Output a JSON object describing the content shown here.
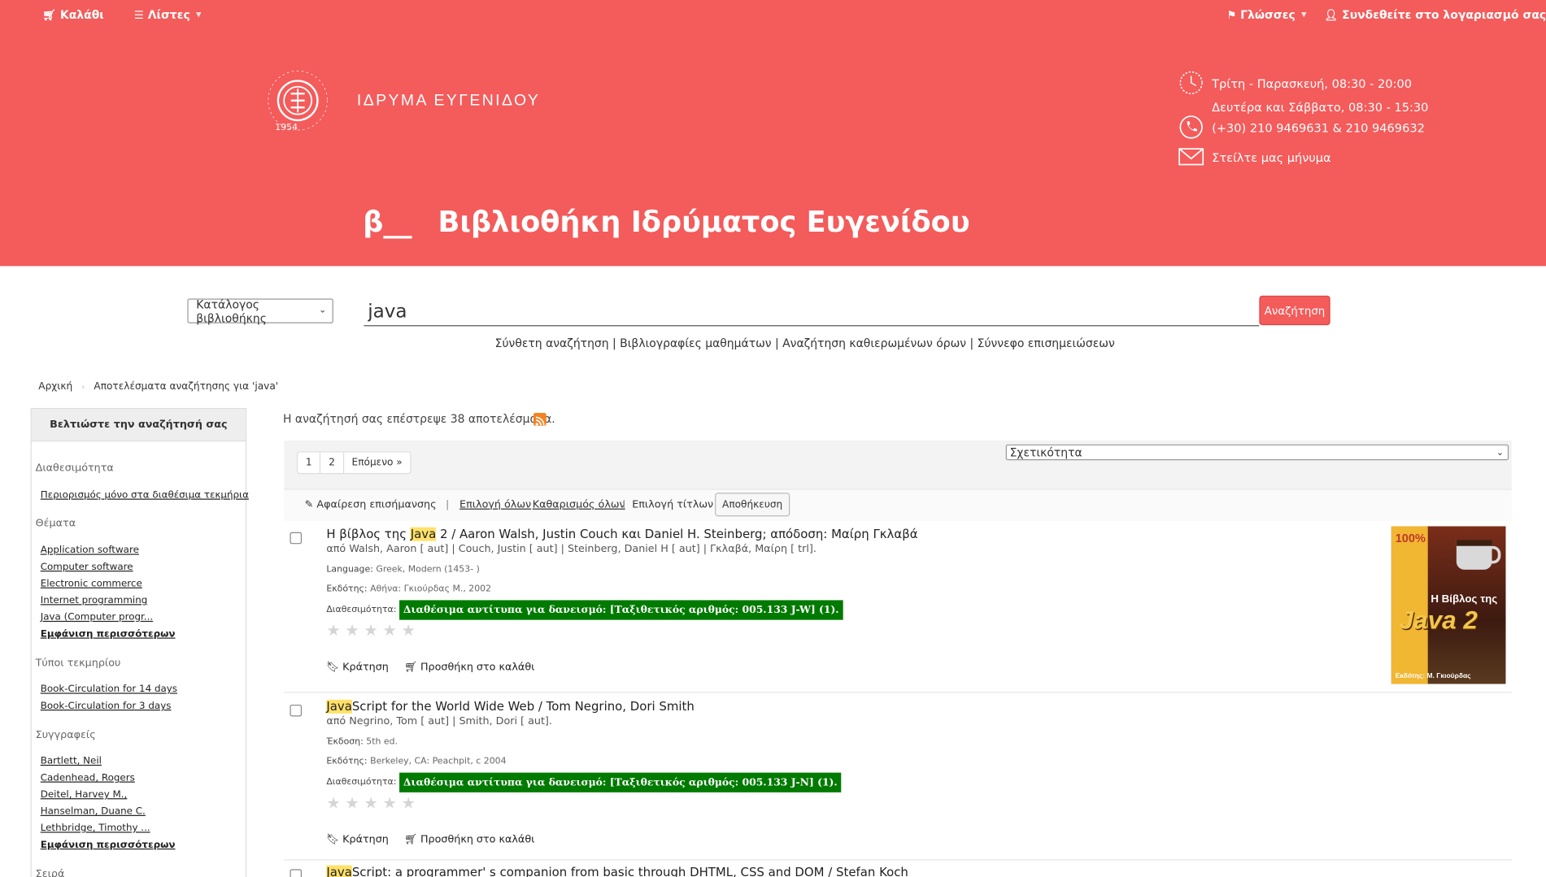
{
  "topnav": {
    "cart": "Καλάθι",
    "lists": "Λίστες",
    "languages": "Γλώσσες",
    "login": "Συνδεθείτε στο λογαριασμό σας"
  },
  "brand": {
    "name": "ΙΔΡΥΜΑ ΕΥΓΕΝΙΔΟΥ",
    "logo_text": "ΙΔΡΥΜΑ ΕΥΓΕΝΙΔΟΥ",
    "logo_year": "1954"
  },
  "info": {
    "hours1": "Τρίτη - Παρασκευή, 08:30 - 20:00",
    "hours2": "Δευτέρα και Σάββατο, 08:30 - 15:30",
    "phone": "(+30) 210 9469631 & 210 9469632",
    "message": "Στείλτε μας μήνυμα"
  },
  "library_title": {
    "symbol": "β__",
    "text": "Βιβλιοθήκη Ιδρύματος Ευγενίδου"
  },
  "search": {
    "catalog_option": "Κατάλογος βιβλιοθήκης",
    "query": "java",
    "button": "Αναζήτηση",
    "links": [
      "Σύνθετη αναζήτηση",
      "Βιβλιογραφίες μαθημάτων",
      "Αναζήτηση καθιερωμένων όρων",
      "Σύννεφο επισημειώσεων"
    ]
  },
  "breadcrumb": {
    "home": "Αρχική",
    "current": "Αποτελέσματα αναζήτησης για 'java'"
  },
  "sidebar": {
    "title": "Βελτιώστε την αναζήτησή σας",
    "availability_title": "Διαθεσιμότητα",
    "availability_link": "Περιορισμός μόνο στα διαθέσιμα τεκμήρια",
    "subjects_title": "Θέματα",
    "subjects": [
      "Application software",
      "Computer software",
      "Electronic commerce",
      "Internet programming",
      "Java (Computer progr..."
    ],
    "subjects_more": "Εμφάνιση περισσότερων",
    "types_title": "Τύποι τεκμηρίου",
    "types": [
      "Book-Circulation for 14 days",
      "Book-Circulation for 3 days"
    ],
    "authors_title": "Συγγραφείς",
    "authors": [
      "Bartlett, Neil",
      "Cadenhead, Rogers",
      "Deitel, Harvey M.,",
      "Hanselman, Duane C.",
      "Lethbridge, Timothy ..."
    ],
    "authors_more": "Εμφάνιση περισσότερων",
    "series_title": "Σειρά"
  },
  "results": {
    "count_text": "Η αναζήτησή σας επέστρεψε 38 αποτελέσματα.",
    "pages": [
      "1",
      "2",
      "Επόμενο »"
    ],
    "sort": "Σχετικότητα",
    "unhighlight": "Αφαίρεση επισήμανσης",
    "select_all": "Επιλογή όλων",
    "clear_all": "Καθαρισμός όλων",
    "select_titles": "Επιλογή τίτλων για:",
    "save": "Αποθήκευση"
  },
  "records": [
    {
      "title_pre": "Η βίβλος της ",
      "title_hl": "Java",
      "title_post": " 2 / Aaron Walsh, Justin Couch και Daniel H. Steinberg; απόδοση: Μαίρη Γκλαβά",
      "authors": "από Walsh, Aaron [ aut] | Couch, Justin [ aut] | Steinberg, Daniel H [ aut] | Γκλαβά, Μαίρη [ trl].",
      "meta1_label": "Language:",
      "meta1_value": "Greek, Modern (1453- )",
      "meta2_label": "Εκδότης:",
      "meta2_value": "Αθήνα: Γκιούρδας Μ., 2002",
      "avail_label": "Διαθεσιμότητα:",
      "avail_badge": "Διαθέσιμα αντίτυπα για δανεισμό: [Ταξιθετικός αριθμός: 005.133 J-W] (1).",
      "hold": "Κράτηση",
      "add_cart": "Προσθήκη στο καλάθι",
      "cover": {
        "pct": "100%",
        "line1": "Η Βίβλος της",
        "line2": "Java 2",
        "publisher": "Εκδότης: Μ. Γκιούρδας"
      }
    },
    {
      "title_pre": "",
      "title_hl": "Java",
      "title_post": "Script for the World Wide Web / Tom Negrino, Dori Smith",
      "authors": "από Negrino, Tom [ aut] | Smith, Dori [ aut].",
      "meta1_label": "Έκδοση:",
      "meta1_value": "5th ed.",
      "meta2_label": "Εκδότης:",
      "meta2_value": "Berkeley, CA: Peachpit, c 2004",
      "avail_label": "Διαθεσιμότητα:",
      "avail_badge": "Διαθέσιμα αντίτυπα για δανεισμό: [Ταξιθετικός αριθμός: 005.133 J-N] (1).",
      "hold": "Κράτηση",
      "add_cart": "Προσθήκη στο καλάθι"
    },
    {
      "title_pre": "",
      "title_hl": "Java",
      "title_post": "Script: a programmer' s companion from basic through DHTML, CSS and DOM / Stefan Koch"
    }
  ],
  "colors": {
    "header": "#f45b5b",
    "avail": "#007a00",
    "highlight": "#ffe169"
  }
}
